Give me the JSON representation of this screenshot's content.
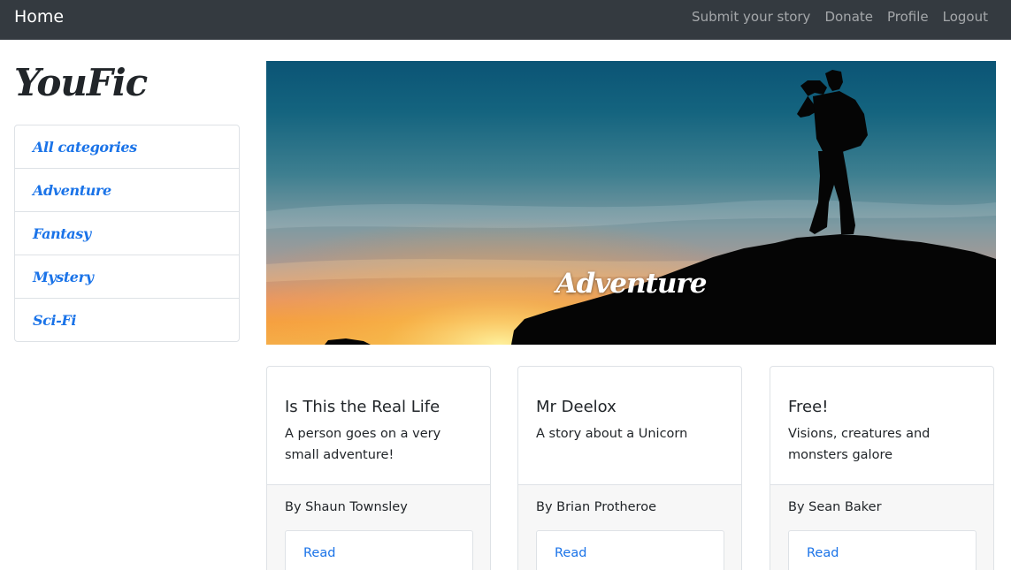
{
  "navbar": {
    "home_label": "Home",
    "links": [
      "Submit your story",
      "Donate",
      "Profile",
      "Logout"
    ]
  },
  "sidebar": {
    "logo": "YouFic",
    "categories": [
      "All categories",
      "Adventure",
      "Fantasy",
      "Mystery",
      "Sci-Fi"
    ]
  },
  "hero": {
    "title": "Adventure"
  },
  "stories": [
    {
      "title": "Is This the Real Life",
      "description": "A person goes on a very small adventure!",
      "author": "By Shaun Townsley",
      "button": "Read"
    },
    {
      "title": "Mr Deelox",
      "description": "A story about a Unicorn",
      "author": "By Brian Protheroe",
      "button": "Read"
    },
    {
      "title": "Free!",
      "description": "Visions, creatures and monsters galore",
      "author": "By Sean Baker",
      "button": "Read"
    }
  ],
  "colors": {
    "navbar_bg": "#343a40",
    "link_blue": "#1a73e8",
    "footer_bg": "#f7f7f7"
  }
}
